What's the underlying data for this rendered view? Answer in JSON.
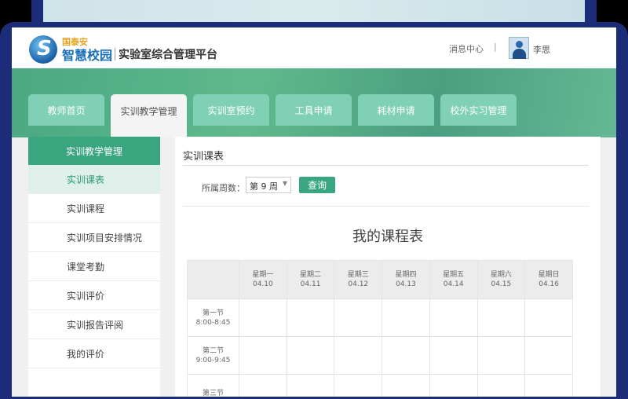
{
  "header": {
    "brand_top": "国泰安",
    "brand_main": "智慧校园",
    "system_title": "实验室综合管理平台",
    "messages": "消息中心",
    "separator": "|",
    "user": "李思"
  },
  "tabs": [
    "教师首页",
    "实训教学管理",
    "实训室预约",
    "工具申请",
    "耗材申请",
    "校外实习管理"
  ],
  "sidebar": {
    "header": "实训教学管理",
    "items": [
      "实训课表",
      "实训课程",
      "实训项目安排情况",
      "课堂考勤",
      "实训评价",
      "实训报告评阅",
      "我的评价"
    ]
  },
  "main": {
    "title": "实训课表",
    "week_label": "所属周数：",
    "week_value": "第 9 周",
    "query": "查询",
    "schedule_title": "我的课程表"
  },
  "schedule": {
    "days": [
      {
        "d": "星期一",
        "date": "04.10"
      },
      {
        "d": "星期二",
        "date": "04.11"
      },
      {
        "d": "星期三",
        "date": "04.12"
      },
      {
        "d": "星期四",
        "date": "04.13"
      },
      {
        "d": "星期五",
        "date": "04.14"
      },
      {
        "d": "星期六",
        "date": "04.15"
      },
      {
        "d": "星期日",
        "date": "04.16"
      }
    ],
    "periods": [
      {
        "name": "第一节",
        "time": "8:00-8:45"
      },
      {
        "name": "第二节",
        "time": "9:00-9:45"
      },
      {
        "name": "第三节",
        "time": ""
      }
    ]
  }
}
